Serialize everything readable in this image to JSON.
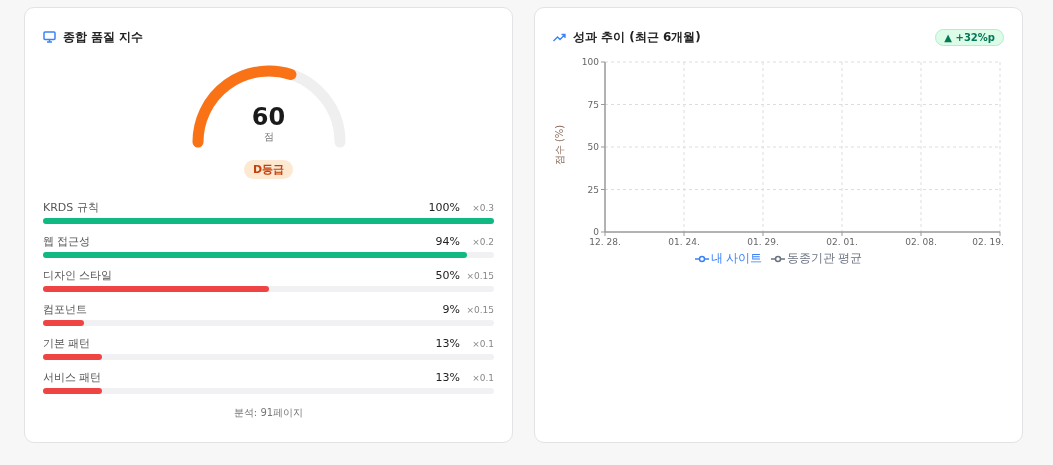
{
  "quality_card": {
    "title": "종합 품질 지수",
    "gauge": {
      "score": "60",
      "unit": "점"
    },
    "grade": "D등급",
    "metrics": [
      {
        "label": "KRDS 규칙",
        "percent": "100%",
        "weight": "×0.3",
        "level": 1.0,
        "color": "#10b981"
      },
      {
        "label": "웹 접근성",
        "percent": "94%",
        "weight": "×0.2",
        "level": 0.94,
        "color": "#10b981"
      },
      {
        "label": "디자인 스타일",
        "percent": "50%",
        "weight": "×0.15",
        "level": 0.5,
        "color": "#ef4444"
      },
      {
        "label": "컴포넌트",
        "percent": "9%",
        "weight": "×0.15",
        "level": 0.09,
        "color": "#ef4444"
      },
      {
        "label": "기본 패턴",
        "percent": "13%",
        "weight": "×0.1",
        "level": 0.13,
        "color": "#ef4444"
      },
      {
        "label": "서비스 패턴",
        "percent": "13%",
        "weight": "×0.1",
        "level": 0.13,
        "color": "#ef4444"
      }
    ],
    "footer": "분석: 91페이지"
  },
  "trend_card": {
    "title": "성과 추이 (최근 6개월)",
    "badge": "▲ +32%p",
    "chart_data": {
      "type": "line",
      "grid": true,
      "ylabel": "점수 (%)",
      "categories": [
        "12. 28.",
        "01. 24.",
        "01. 29.",
        "02. 01.",
        "02. 08.",
        "02. 19."
      ],
      "ylim": [
        0,
        100
      ],
      "yticks": [
        0,
        25,
        50,
        75,
        100
      ],
      "series": [
        {
          "name": "내 사이트",
          "color": "#3b82f6",
          "values": [
            null,
            null,
            null,
            null,
            null,
            null
          ]
        },
        {
          "name": "동종기관 평균",
          "color": "#6b7280",
          "values": [
            null,
            null,
            null,
            null,
            null,
            null
          ]
        }
      ]
    }
  }
}
